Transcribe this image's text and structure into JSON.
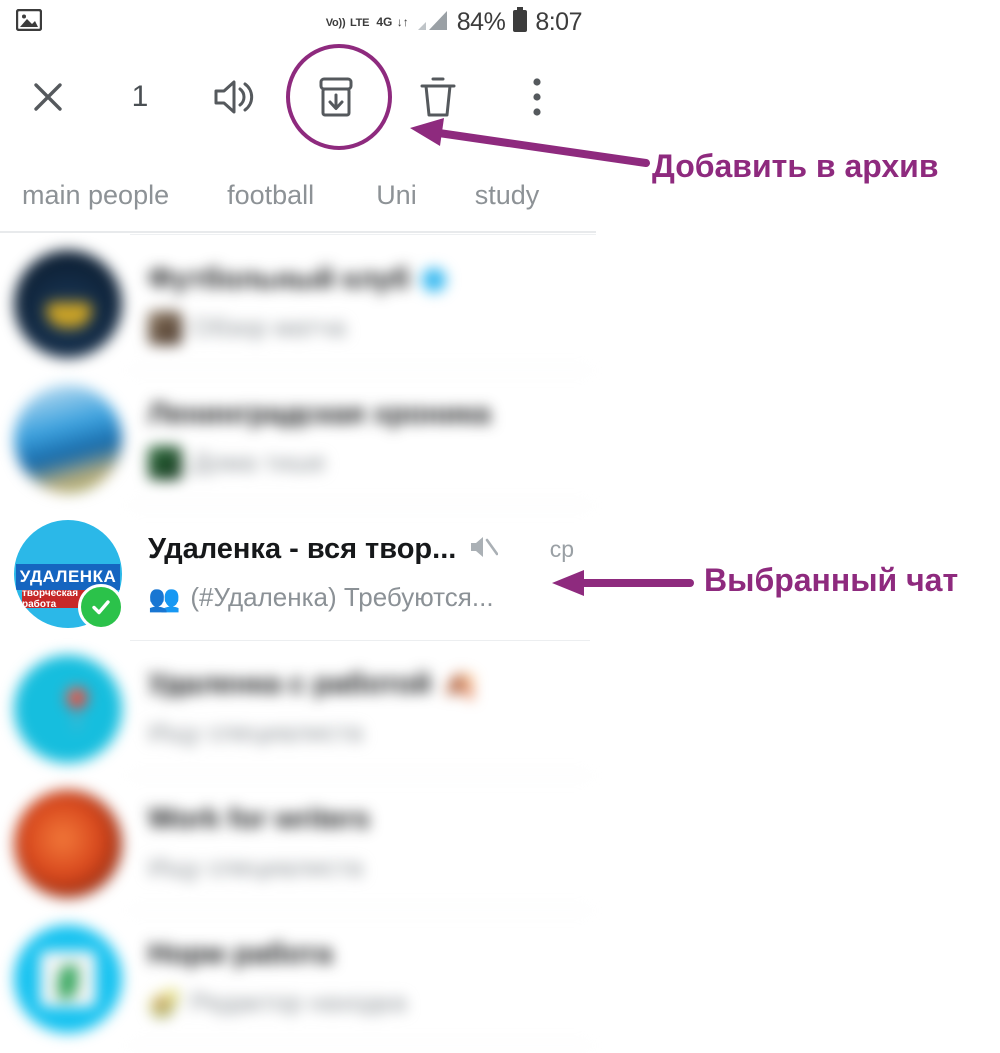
{
  "status_bar": {
    "left_icons": [
      {
        "name": "image-icon",
        "glyph": "ὛC"
      }
    ],
    "volte_line1": "Vo))",
    "volte_line2": "LTE",
    "network_type": "4G",
    "network_arrows": "↓↑",
    "battery_percent": "84%",
    "time": "8:07"
  },
  "action_bar": {
    "close_label": "✕",
    "selection_count": "1",
    "items": [
      {
        "name": "close-button",
        "label": "close"
      },
      {
        "name": "selection-count",
        "label": "1"
      },
      {
        "name": "unmute-button",
        "label": "unmute"
      },
      {
        "name": "archive-button",
        "label": "archive"
      },
      {
        "name": "delete-button",
        "label": "delete"
      },
      {
        "name": "overflow-button",
        "label": "more"
      }
    ]
  },
  "tabs": [
    {
      "label": "main people",
      "active": false
    },
    {
      "label": "football",
      "active": false
    },
    {
      "label": "Uni",
      "active": false
    },
    {
      "label": "study",
      "active": false
    }
  ],
  "chats": [
    {
      "title": "Футбольный клуб",
      "preview": "Обзор матча",
      "time": "",
      "blurred": true,
      "verified": true,
      "selected": false
    },
    {
      "title": "Ленинградская хроника",
      "preview": "Дома тише",
      "time": "",
      "blurred": true,
      "verified": false,
      "selected": false
    },
    {
      "title": "Удаленка - вся твор...",
      "preview": "(#Удаленка) Требуются...",
      "preview_emoji": "👥",
      "time": "ср",
      "muted": true,
      "blurred": false,
      "verified": false,
      "selected": true,
      "avatar": {
        "band1": "УДАЛЕНКА",
        "band2": "творческая работа",
        "check": "✓"
      }
    },
    {
      "title": "Удаленка с работой",
      "preview": "Ищу специалиста",
      "time": "",
      "blurred": true,
      "verified": false,
      "selected": false
    },
    {
      "title": "Work for writers",
      "preview": "Ищу специалиста",
      "time": "",
      "blurred": true,
      "verified": false,
      "selected": false
    },
    {
      "title": "Норм работа",
      "preview": "Редактор находка",
      "time": "",
      "blurred": true,
      "verified": false,
      "selected": false
    }
  ],
  "annotations": {
    "archive_label": "Добавить в архив",
    "selected_chat_label": "Выбранный чат",
    "color": "#8e2a7e"
  }
}
